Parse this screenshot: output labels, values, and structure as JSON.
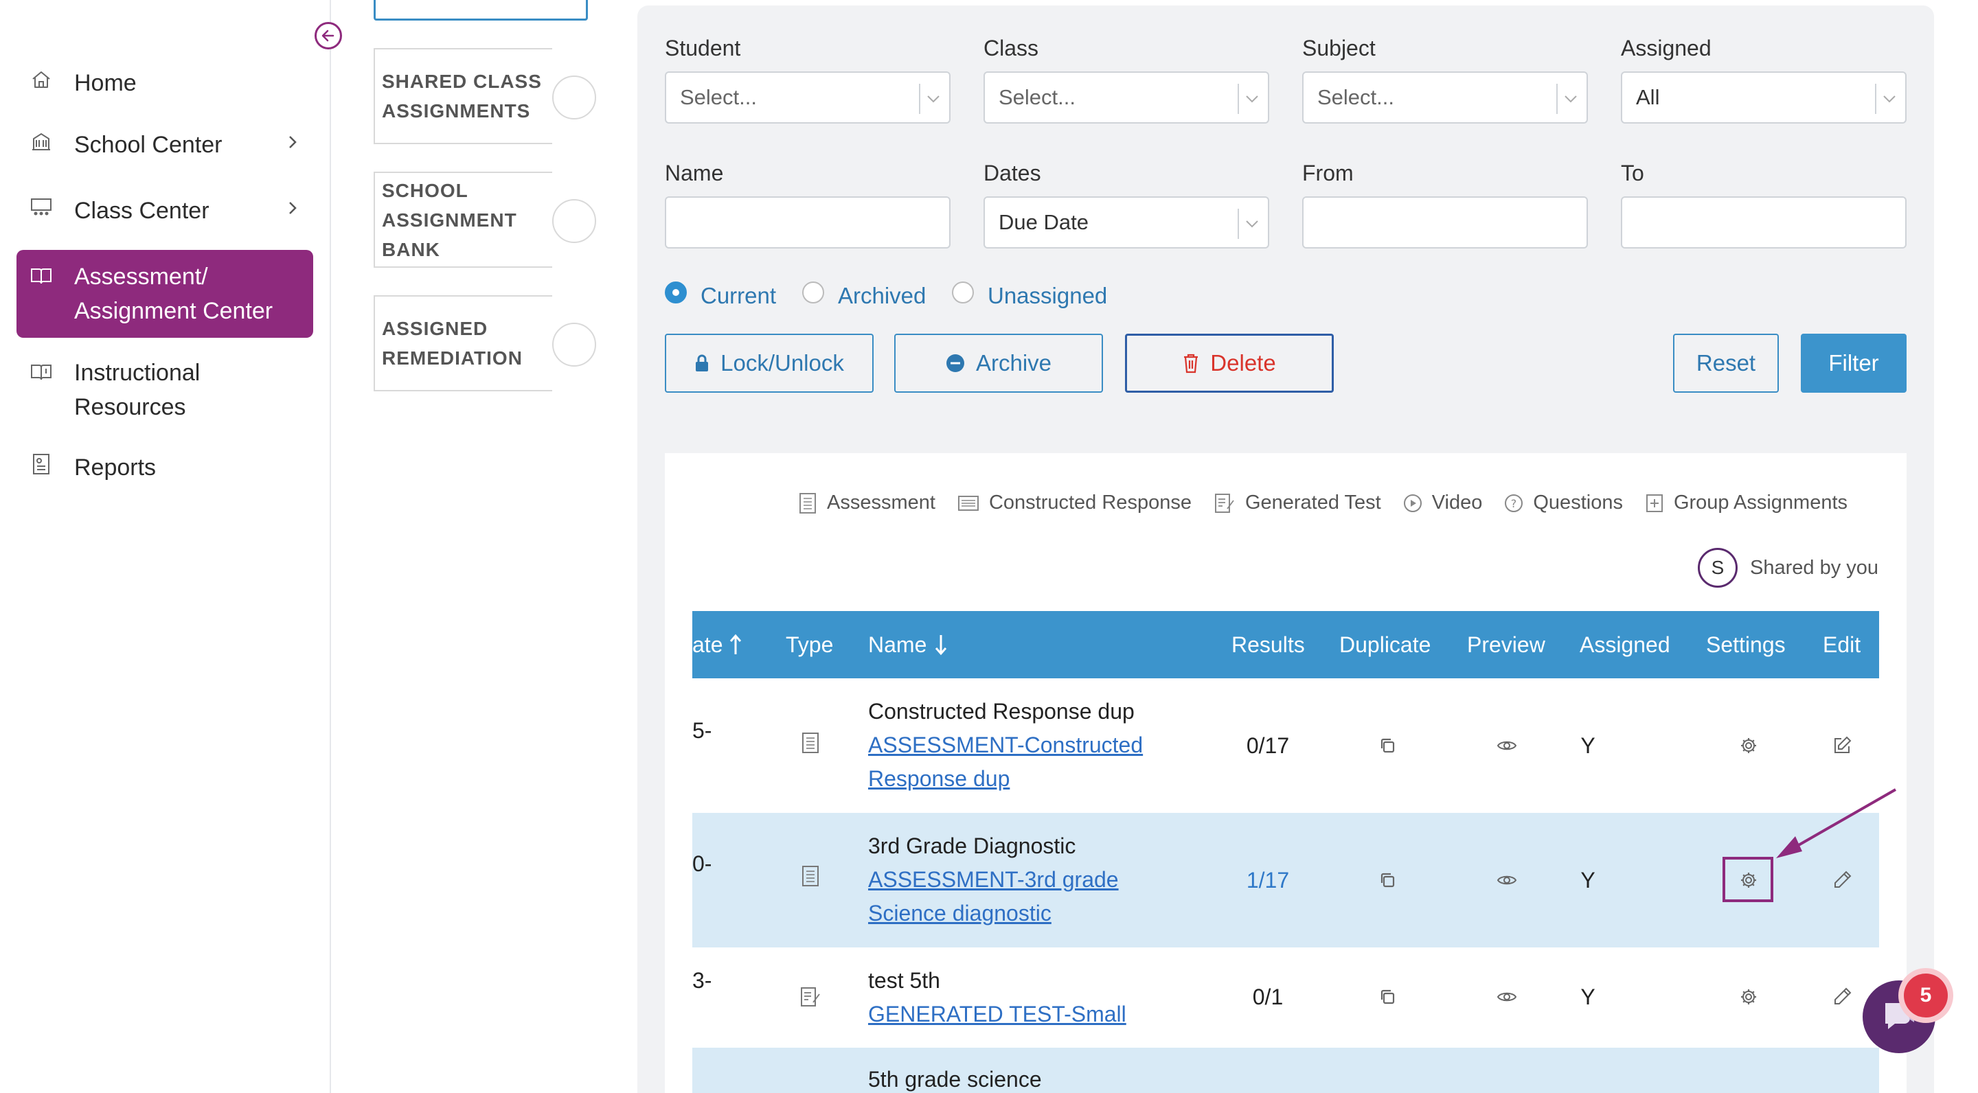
{
  "sidebar": {
    "items": [
      {
        "label": "Home",
        "icon": "home-icon"
      },
      {
        "label": "School Center",
        "icon": "building-icon"
      },
      {
        "label": "Class Center",
        "icon": "classroom-icon"
      },
      {
        "label": "Assessment/ Assignment Center",
        "icon": "book-icon"
      },
      {
        "label": "Instructional Resources",
        "icon": "book-info-icon"
      },
      {
        "label": "Reports",
        "icon": "report-icon"
      }
    ],
    "item_lines": {
      "assessment_1": "Assessment/",
      "assessment_2": "Assignment Center",
      "instructional_1": "Instructional",
      "instructional_2": "Resources"
    }
  },
  "cards": [
    {
      "lines": [
        "SHARED CLASS",
        "ASSIGNMENTS"
      ]
    },
    {
      "lines": [
        "SCHOOL",
        "ASSIGNMENT",
        "BANK"
      ]
    },
    {
      "lines": [
        "ASSIGNED",
        "REMEDIATION"
      ]
    }
  ],
  "filters": {
    "student": {
      "label": "Student",
      "value": "Select..."
    },
    "class": {
      "label": "Class",
      "value": "Select..."
    },
    "subject": {
      "label": "Subject",
      "value": "Select..."
    },
    "assigned": {
      "label": "Assigned",
      "value": "All"
    },
    "name": {
      "label": "Name",
      "value": ""
    },
    "dates": {
      "label": "Dates",
      "value": "Due Date"
    },
    "from": {
      "label": "From",
      "value": ""
    },
    "to": {
      "label": "To",
      "value": ""
    }
  },
  "status_radios": {
    "selected": "Current",
    "options": [
      "Current",
      "Archived",
      "Unassigned"
    ]
  },
  "actions": {
    "lock": "Lock/Unlock",
    "archive": "Archive",
    "delete": "Delete",
    "reset": "Reset",
    "filter": "Filter"
  },
  "legend": {
    "assessment": "Assessment",
    "constructed": "Constructed Response",
    "generated": "Generated Test",
    "video": "Video",
    "questions": "Questions",
    "group": "Group Assignments",
    "shared_badge": "S",
    "shared_label": "Shared by you"
  },
  "table": {
    "headers": {
      "date": "ate",
      "type": "Type",
      "name": "Name",
      "results": "Results",
      "duplicate": "Duplicate",
      "preview": "Preview",
      "assigned": "Assigned",
      "settings": "Settings",
      "edit": "Edit"
    },
    "rows": [
      {
        "date": "5-",
        "type_icon": "assessment-icon",
        "title": "Constructed Response dup",
        "link1": "ASSESSMENT-Constructed",
        "link2": "Response dup",
        "results": "0/17",
        "assigned": "Y",
        "highlighted": false
      },
      {
        "date": "0-",
        "type_icon": "assessment-icon",
        "title": "3rd Grade Diagnostic",
        "link1": "ASSESSMENT-3rd grade",
        "link2": "Science diagnostic",
        "results": "1/17",
        "assigned": "Y",
        "highlighted": true
      },
      {
        "date": "3-",
        "type_icon": "generated-test-icon",
        "title": "test 5th",
        "link1": "GENERATED TEST-Small",
        "link2": "",
        "results": "0/1",
        "assigned": "Y",
        "highlighted": false
      },
      {
        "date": "",
        "type_icon": "",
        "title": "5th grade science",
        "link1": "",
        "link2": "",
        "results": "",
        "assigned": "",
        "highlighted": false
      }
    ]
  },
  "chat": {
    "badge_count": "5"
  },
  "colors": {
    "brand": "#8e2a7d",
    "accent": "#3c94cc",
    "danger": "#d9342b",
    "row_highlight": "#d8eaf6"
  }
}
